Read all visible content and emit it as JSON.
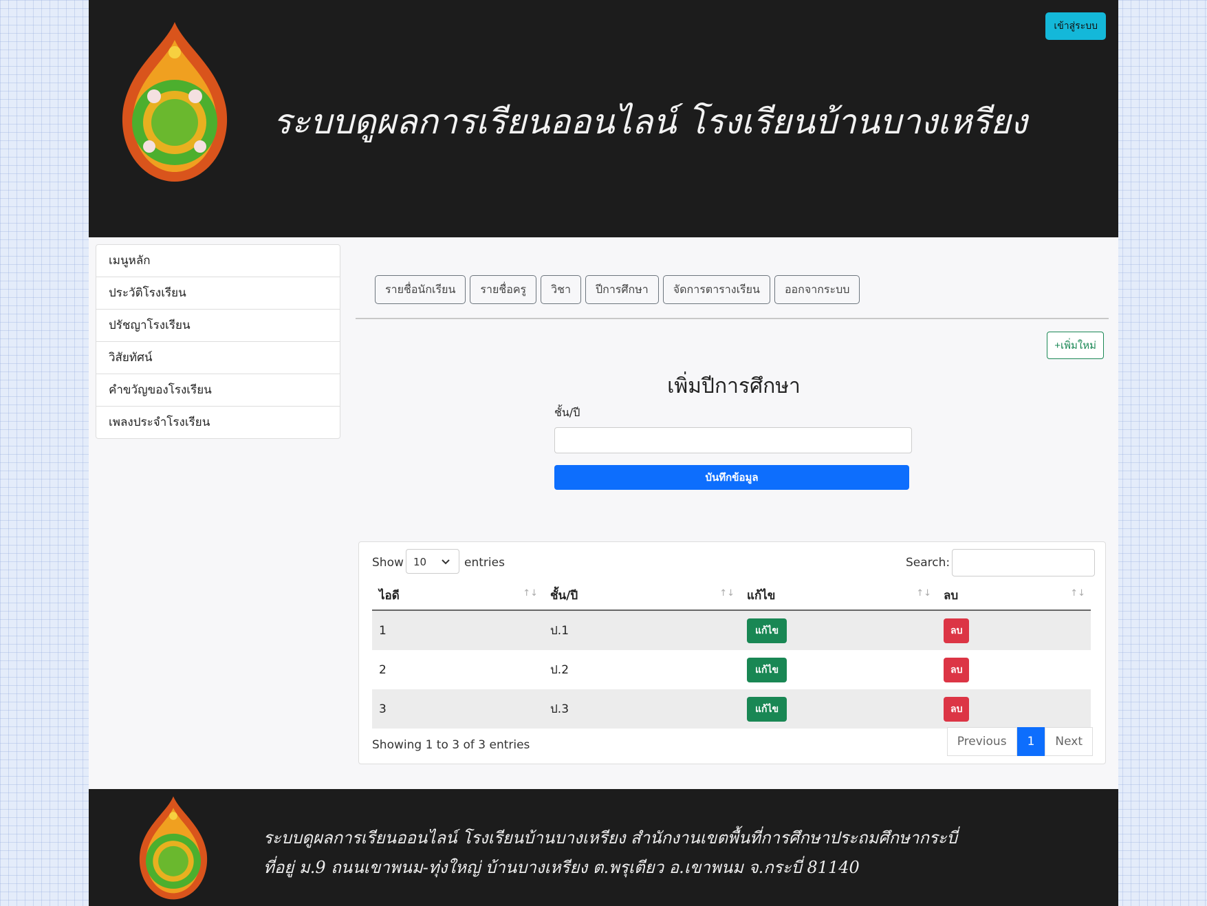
{
  "header": {
    "login_label": "เข้าสู่ระบบ",
    "title": "ระบบดูผลการเรียนออนไลน์ โรงเรียนบ้านบางเหรียง"
  },
  "sidebar": {
    "items": [
      {
        "label": "เมนูหลัก"
      },
      {
        "label": "ประวัติโรงเรียน"
      },
      {
        "label": "ปรัชญาโรงเรียน"
      },
      {
        "label": "วิสัยทัศน์"
      },
      {
        "label": "คำขวัญของโรงเรียน"
      },
      {
        "label": "เพลงประจำโรงเรียน"
      }
    ]
  },
  "nav": {
    "tabs": [
      {
        "label": "รายชื่อนักเรียน"
      },
      {
        "label": "รายชื่อครู"
      },
      {
        "label": "วิชา"
      },
      {
        "label": "ปีการศึกษา"
      },
      {
        "label": "จัดการตารางเรียน"
      },
      {
        "label": "ออกจากระบบ"
      }
    ]
  },
  "form": {
    "add_new_label": "+เพิ่มใหม่",
    "title": "เพิ่มปีการศึกษา",
    "field_label": "ชั้น/ปี",
    "field_value": "",
    "save_label": "บันทึกข้อมูล"
  },
  "table": {
    "show_label": "Show",
    "length_value": "10",
    "entries_label": "entries",
    "search_label": "Search:",
    "columns": [
      "ไอดี",
      "ชั้น/ปี",
      "แก้ไข",
      "ลบ"
    ],
    "rows": [
      {
        "id": "1",
        "grade": "ป.1",
        "edit": "แก้ไข",
        "delete": "ลบ"
      },
      {
        "id": "2",
        "grade": "ป.2",
        "edit": "แก้ไข",
        "delete": "ลบ"
      },
      {
        "id": "3",
        "grade": "ป.3",
        "edit": "แก้ไข",
        "delete": "ลบ"
      }
    ],
    "info": "Showing 1 to 3 of 3 entries",
    "pagination": {
      "previous": "Previous",
      "current": "1",
      "next": "Next"
    }
  },
  "footer": {
    "line1": "ระบบดูผลการเรียนออนไลน์ โรงเรียนบ้านบางเหรียง  สำนักงานเขตพื้นที่การศึกษาประถมศึกษากระบี่",
    "line2": "ที่อยู่ ม.9 ถนนเขาพนม-ทุ่งใหญ่  บ้านบางเหรียง  ต.พรุเตียว  อ.เขาพนม จ.กระบี่  81140"
  },
  "colors": {
    "header_bg": "#1c1c1c",
    "login_btn": "#14b8d9",
    "primary": "#0d6efd",
    "success": "#198754",
    "danger": "#dc3545"
  }
}
